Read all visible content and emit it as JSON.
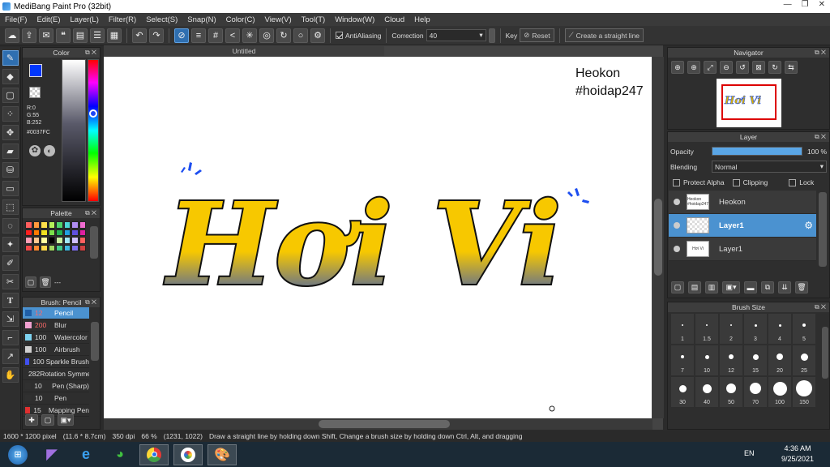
{
  "window": {
    "title": "MediBang Paint Pro (32bit)"
  },
  "menu": [
    "File(F)",
    "Edit(E)",
    "Layer(L)",
    "Filter(R)",
    "Select(S)",
    "Snap(N)",
    "Color(C)",
    "View(V)",
    "Tool(T)",
    "Window(W)",
    "Cloud",
    "Help"
  ],
  "toolbar": {
    "antialiasing_label": "AntiAliasing",
    "correction_label": "Correction",
    "correction_value": "40",
    "key_label": "Key",
    "reset_label": "Reset",
    "straight_line_label": "Create a straight line"
  },
  "color_panel": {
    "title": "Color",
    "r": "R:0",
    "g": "G:55",
    "b": "B:252",
    "hex": "#0037FC",
    "primary_color": "#0037fc",
    "secondary_color": "#ff8c00"
  },
  "palette_panel": {
    "title": "Palette",
    "footer_text": "---",
    "colors": [
      "#ff5e5e",
      "#ff9a3c",
      "#ffe04a",
      "#b6f05a",
      "#4fd46c",
      "#4dd6d6",
      "#b08df0",
      "#f06bd0",
      "#ff1f1f",
      "#ff7a00",
      "#f0e020",
      "#7ae04a",
      "#20b050",
      "#20a0e0",
      "#6050e0",
      "#e020a0",
      "#ff9fb6",
      "#ffc890",
      "#ffffa0",
      "#000000",
      "#c8f0a0",
      "#a0e8f8",
      "#d0c0ff",
      "#ff6060",
      "#f04848",
      "#ff8a30",
      "#ffd84a",
      "#a0d860",
      "#40c888",
      "#40b8e0",
      "#8070f0",
      "#d04040"
    ]
  },
  "brush_panel": {
    "title": "Brush: Pencil",
    "items": [
      {
        "size": "12",
        "name": "Pencil",
        "color": "#1f5fa8"
      },
      {
        "size": "200",
        "name": "Blur",
        "color": "#f0a0d0"
      },
      {
        "size": "100",
        "name": "Watercolor",
        "color": "#7dd3f0"
      },
      {
        "size": "100",
        "name": "Airbrush",
        "color": "#d0d0d0"
      },
      {
        "size": "100",
        "name": "Sparkle Brush",
        "color": "#4050f0"
      },
      {
        "size": "282",
        "name": "Rotation Symmetry",
        "color": "#e03030"
      },
      {
        "size": "10",
        "name": "Pen (Sharp)",
        "color": "#303030"
      },
      {
        "size": "10",
        "name": "Pen",
        "color": "#303030"
      },
      {
        "size": "15",
        "name": "Mapping Pen",
        "color": "#e03030"
      }
    ]
  },
  "canvas": {
    "tab_title": "Untitled",
    "watermark_line1": "Heokon",
    "watermark_line2": "#hoidap247",
    "artwork_text": "Hơi Vi",
    "gradient_top": "#f7c800",
    "gradient_bottom": "#1040e0"
  },
  "navigator_panel": {
    "title": "Navigator"
  },
  "layer_panel": {
    "title": "Layer",
    "opacity_label": "Opacity",
    "opacity_value": "100 %",
    "opacity": 1.0,
    "blending_label": "Blending",
    "blending_value": "Normal",
    "protect_alpha_label": "Protect Alpha",
    "clipping_label": "Clipping",
    "lock_label": "Lock",
    "layers": [
      {
        "name": "Heokon",
        "thumb": "Heokon #hoidap247",
        "active": false
      },
      {
        "name": "Layer1",
        "thumb": "",
        "active": true
      },
      {
        "name": "Layer1",
        "thumb": "Hơi Vi",
        "active": false
      }
    ]
  },
  "brush_size_panel": {
    "title": "Brush Size",
    "sizes": [
      "1",
      "1.5",
      "2",
      "3",
      "4",
      "5",
      "7",
      "10",
      "12",
      "15",
      "20",
      "25",
      "30",
      "40",
      "50",
      "70",
      "100",
      "150"
    ]
  },
  "status_bar": {
    "dimensions": "1600 * 1200 pixel",
    "physical": "(11.6 * 8.7cm)",
    "dpi": "350 dpi",
    "zoom": "66 %",
    "coords": "(1231, 1022)",
    "hint": "Draw a straight line by holding down Shift, Change a brush size by holding down Ctrl, Alt, and dragging"
  },
  "taskbar": {
    "language": "EN",
    "time": "4:36 AM",
    "date": "9/25/2021"
  }
}
